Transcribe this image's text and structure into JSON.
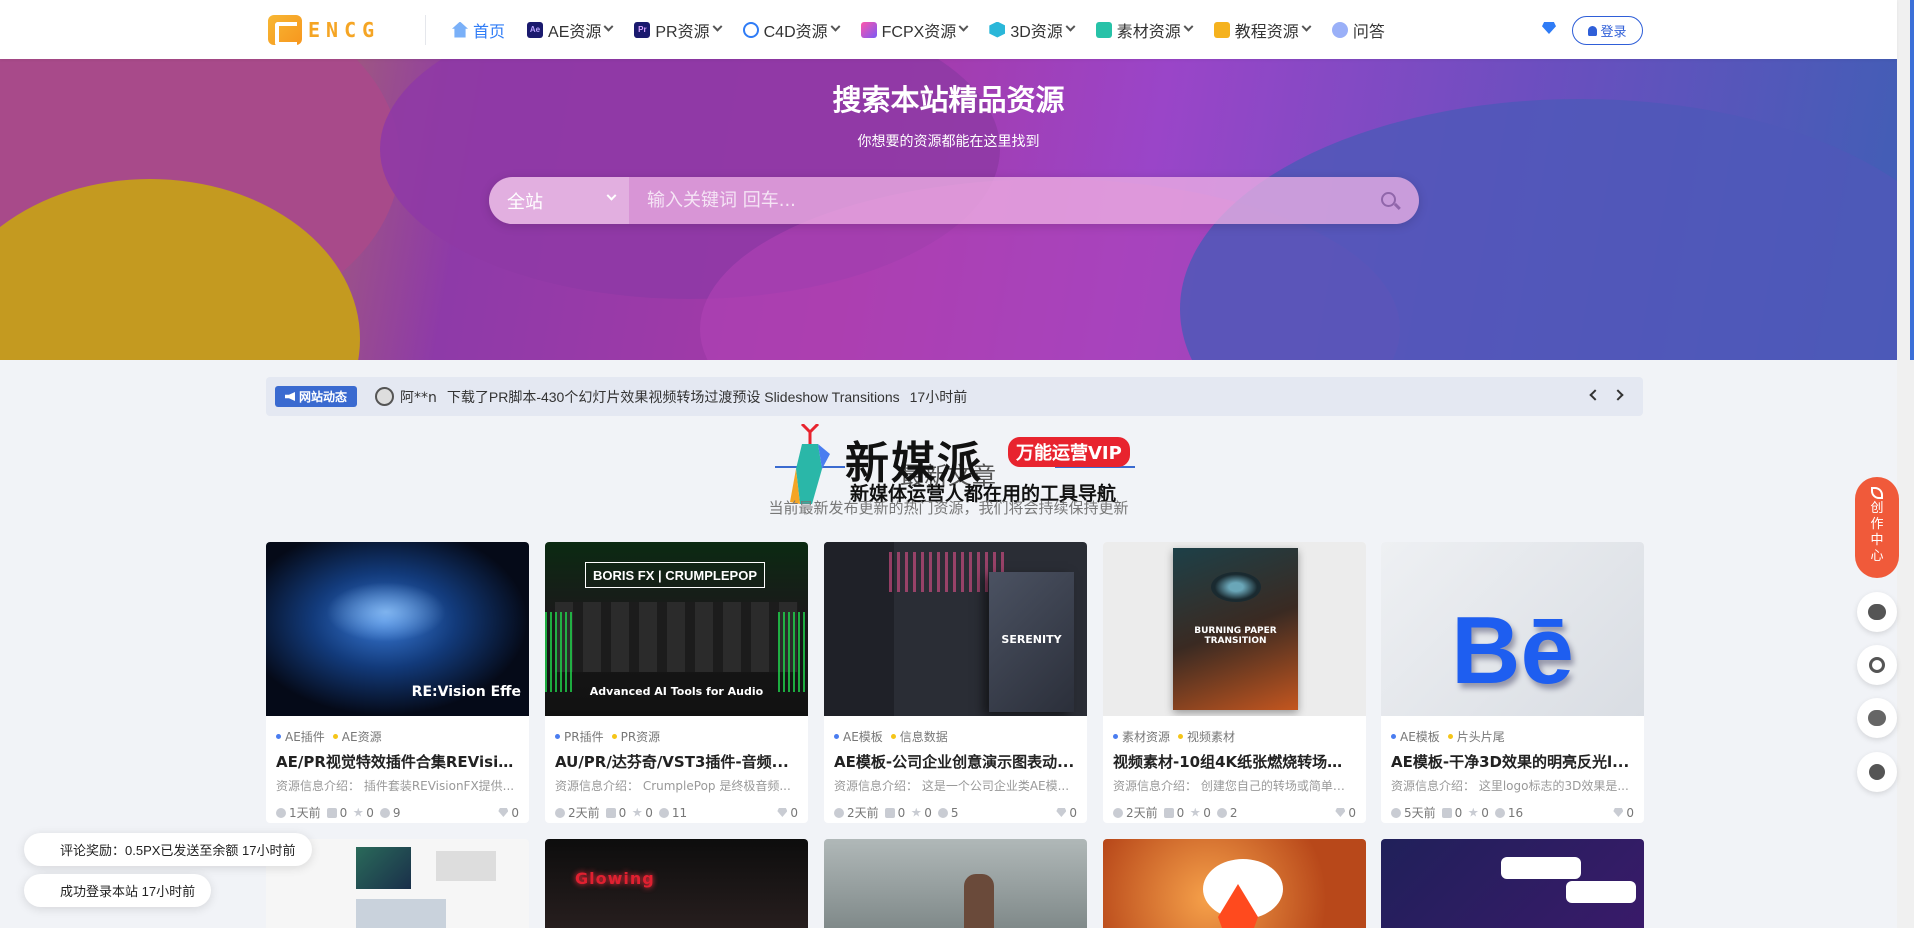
{
  "logo": {
    "text": "ENCG"
  },
  "nav": [
    {
      "label": "首页",
      "icon": "home-icon",
      "active": true
    },
    {
      "label": "AE资源",
      "icon": "ae-icon",
      "color": "#1a1a6e",
      "badge": "Ae"
    },
    {
      "label": "PR资源",
      "icon": "pr-icon",
      "color": "#1a1a6e",
      "badge": "Pr"
    },
    {
      "label": "C4D资源",
      "icon": "c4d-icon",
      "color": "#2f7cf6",
      "badge": ""
    },
    {
      "label": "FCPX资源",
      "icon": "fcpx-icon",
      "color": "#7a5af5",
      "badge": ""
    },
    {
      "label": "3D资源",
      "icon": "cube-icon",
      "color": "#2ab7d9",
      "badge": ""
    },
    {
      "label": "素材资源",
      "icon": "clapper-icon",
      "color": "#27c2a8",
      "badge": ""
    },
    {
      "label": "教程资源",
      "icon": "tutorial-icon",
      "color": "#f5b21e",
      "badge": ""
    },
    {
      "label": "问答",
      "icon": "chat-icon",
      "color": "#7a9af5",
      "badge": ""
    }
  ],
  "header": {
    "login_label": "登录"
  },
  "hero": {
    "title": "搜索本站精品资源",
    "subtitle": "你想要的资源都能在这里找到",
    "scope": "全站",
    "placeholder": "输入关键词 回车..."
  },
  "ticker": {
    "badge": "网站动态",
    "user": "阿**n",
    "text": "下载了PR脚本-430个幻灯片效果视频转场过渡预设 Slideshow Transitions",
    "time": "17小时前"
  },
  "ad": {
    "title": "新媒派",
    "pill": "万能运营VIP",
    "subtitle": "新媒体运营人都在用的工具导航"
  },
  "section": {
    "heading": "最新文章",
    "description": "当前最新发布更新的热门资源，我们将会持续保持更新"
  },
  "cards": [
    {
      "thumb_caption": "RE:Vision Effe",
      "tags": [
        [
          "AE插件",
          "#4a7df0"
        ],
        [
          "AE资源",
          "#f5c518"
        ]
      ],
      "title": "AE/PR视觉特效插件合集REVisio...",
      "desc": "资源信息介绍： 插件套装REVisionFX提供...",
      "time": "1天前",
      "likes": "0",
      "stars": "0",
      "views": "9",
      "gems": "0"
    },
    {
      "thumb_caption": "Advanced AI Tools for Audio",
      "tags": [
        [
          "PR插件",
          "#4a7df0"
        ],
        [
          "PR资源",
          "#f5c518"
        ]
      ],
      "title": "AU/PR/达芬奇/VST3插件-音频...",
      "desc": "资源信息介绍： CrumplePop 是终极音频...",
      "time": "2天前",
      "likes": "0",
      "stars": "0",
      "views": "11",
      "gems": "0"
    },
    {
      "thumb_caption": "SERENITY",
      "tags": [
        [
          "AE模板",
          "#4a7df0"
        ],
        [
          "信息数据",
          "#f5c518"
        ]
      ],
      "title": "AE模板-公司企业创意演示图表动...",
      "desc": "资源信息介绍： 这是一个公司企业类AE模...",
      "time": "2天前",
      "likes": "0",
      "stars": "0",
      "views": "5",
      "gems": "0"
    },
    {
      "thumb_caption": "BURNING PAPER TRANSITION",
      "tags": [
        [
          "素材资源",
          "#4a7df0"
        ],
        [
          "视频素材",
          "#f5c518"
        ]
      ],
      "title": "视频素材-10组4K纸张燃烧转场过...",
      "desc": "资源信息介绍： 创建您自己的转场或简单地...",
      "time": "2天前",
      "likes": "0",
      "stars": "0",
      "views": "2",
      "gems": "0"
    },
    {
      "thumb_caption": "Bē",
      "tags": [
        [
          "AE模板",
          "#4a7df0"
        ],
        [
          "片头片尾",
          "#f5c518"
        ]
      ],
      "title": "AE模板-干净3D效果的明亮反光l...",
      "desc": "资源信息介绍： 这里logo标志的3D效果是...",
      "time": "5天前",
      "likes": "0",
      "stars": "0",
      "views": "16",
      "gems": "0"
    }
  ],
  "side": {
    "create_label": "创作中心"
  },
  "toasts": [
    {
      "text": "评论奖励：0.5PX已发送至余额 17小时前"
    },
    {
      "text": "成功登录本站 17小时前"
    }
  ]
}
